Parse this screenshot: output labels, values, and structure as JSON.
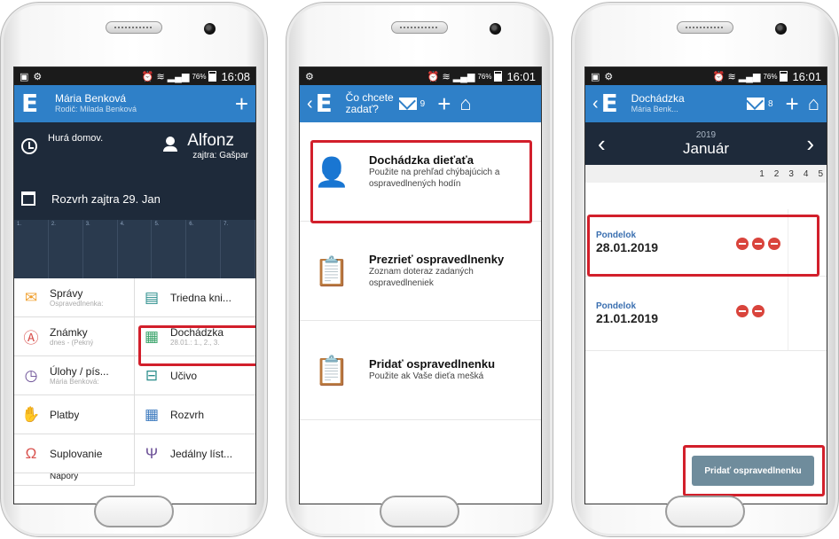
{
  "phone1": {
    "status": {
      "battery": "76%",
      "time": "16:08"
    },
    "header": {
      "name": "Mária Benková",
      "sub": "Rodič: Milada Benková"
    },
    "dash": {
      "greeting": "Hurá domov.",
      "child": "Alfonz",
      "nameday": "zajtra: Gašpar",
      "schedule": "Rozvrh zajtra 29. Jan"
    },
    "grid_cols": [
      "1.",
      "2.",
      "3.",
      "4.",
      "5.",
      "6.",
      "7."
    ],
    "menu": [
      {
        "label": "Správy",
        "sub": "Ospravedlnenka:",
        "icon": "envelope-icon"
      },
      {
        "label": "Triedna kni...",
        "sub": "",
        "icon": "book-icon"
      },
      {
        "label": "Známky",
        "sub": "dnes - (Pekný",
        "icon": "grade-icon"
      },
      {
        "label": "Dochádzka",
        "sub": "28.01.: 1., 2., 3.",
        "icon": "attendance-icon"
      },
      {
        "label": "Úlohy / pís...",
        "sub": "Mária Benková:",
        "icon": "clock-icon"
      },
      {
        "label": "Učivo",
        "sub": "",
        "icon": "folder-icon"
      },
      {
        "label": "Platby",
        "sub": "",
        "icon": "money-icon"
      },
      {
        "label": "Rozvrh",
        "sub": "",
        "icon": "timetable-icon"
      },
      {
        "label": "Suplovanie",
        "sub": "",
        "icon": "substitute-icon"
      },
      {
        "label": "Jedálny líst...",
        "sub": "",
        "icon": "food-icon"
      }
    ],
    "partial": "Nápory"
  },
  "phone2": {
    "status": {
      "battery": "76%",
      "time": "16:01"
    },
    "header": {
      "title": "Čo chcete zadať?",
      "mail_count": "9"
    },
    "options": [
      {
        "title": "Dochádzka dieťaťa",
        "desc": "Použite na prehľad chýbajúcich a ospravedlnených hodín"
      },
      {
        "title": "Prezrieť ospravedlnenky",
        "desc": "Zoznam doteraz zadaných ospravedlneniek"
      },
      {
        "title": "Pridať ospravedlnenku",
        "desc": "Použite ak Vaše dieťa mešká"
      }
    ]
  },
  "phone3": {
    "status": {
      "battery": "76%",
      "time": "16:01"
    },
    "header": {
      "title": "Dochádzka",
      "sub": "Mária Benk...",
      "mail_count": "8"
    },
    "year": "2019",
    "month": "Január",
    "hours": [
      "1",
      "2",
      "3",
      "4",
      "5"
    ],
    "days": [
      {
        "weekday": "Pondelok",
        "date": "28.01.2019",
        "absences": 3
      },
      {
        "weekday": "Pondelok",
        "date": "21.01.2019",
        "absences": 2
      }
    ],
    "add_button": "Pridať ospravedlnenku"
  }
}
